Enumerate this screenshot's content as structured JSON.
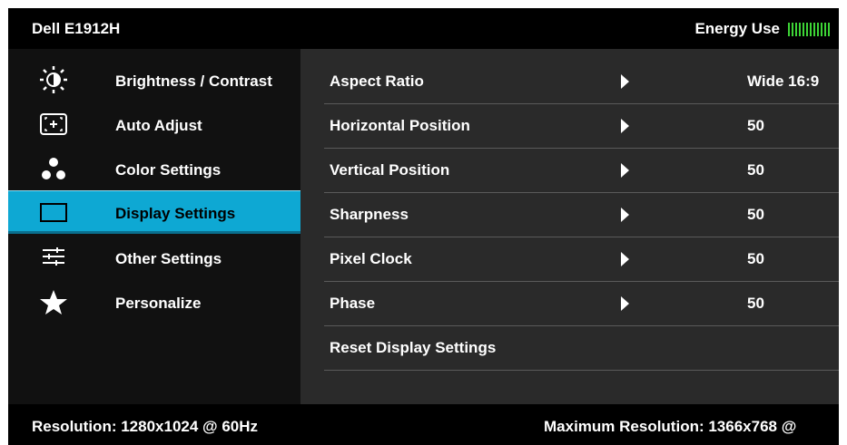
{
  "header": {
    "model": "Dell E1912H",
    "energy_label": "Energy Use",
    "energy_level_bars": 12,
    "energy_color": "#3dd436"
  },
  "menu": {
    "selected_index": 3,
    "selected_color": "#0ea8d3",
    "items": [
      {
        "label": "Brightness / Contrast",
        "icon": "brightness-icon"
      },
      {
        "label": "Auto Adjust",
        "icon": "auto-adjust-icon"
      },
      {
        "label": "Color Settings",
        "icon": "color-settings-icon"
      },
      {
        "label": "Display Settings",
        "icon": "display-settings-icon"
      },
      {
        "label": "Other Settings",
        "icon": "other-settings-icon"
      },
      {
        "label": "Personalize",
        "icon": "star-icon"
      }
    ]
  },
  "settings": {
    "rows": [
      {
        "label": "Aspect Ratio",
        "value": "Wide 16:9"
      },
      {
        "label": "Horizontal Position",
        "value": "50"
      },
      {
        "label": "Vertical Position",
        "value": "50"
      },
      {
        "label": "Sharpness",
        "value": "50"
      },
      {
        "label": "Pixel Clock",
        "value": "50"
      },
      {
        "label": "Phase",
        "value": "50"
      },
      {
        "label": "Reset Display Settings",
        "value": ""
      }
    ]
  },
  "footer": {
    "resolution": "Resolution: 1280x1024 @ 60Hz",
    "max_resolution": "Maximum Resolution: 1366x768 @"
  }
}
